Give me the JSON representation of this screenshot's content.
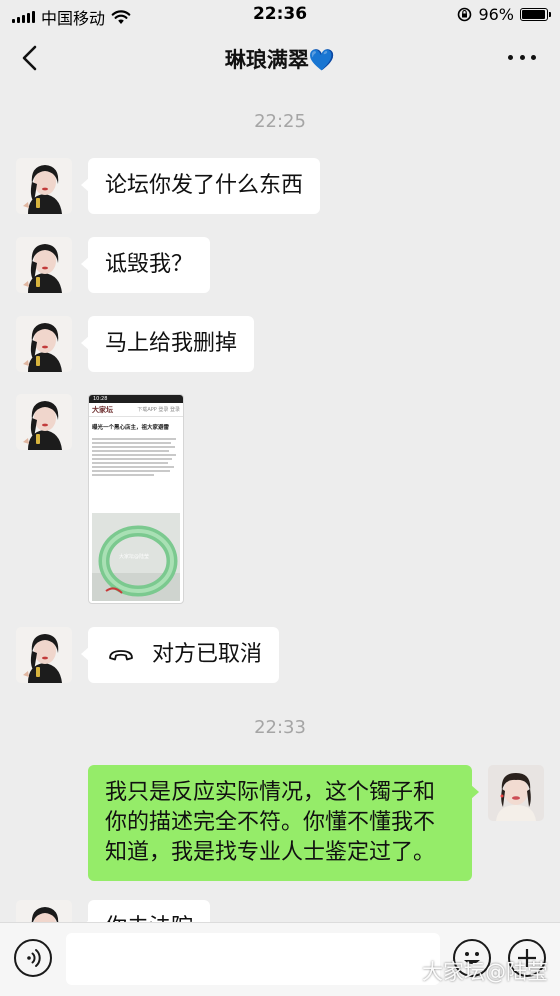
{
  "status_bar": {
    "carrier": "中国移动",
    "time": "22:36",
    "battery": "96%",
    "battery_level": 0.96
  },
  "header": {
    "title": "琳琅满翠💙"
  },
  "timestamps": [
    "22:25",
    "22:33"
  ],
  "messages": [
    {
      "side": "left",
      "text": "论坛你发了什么东西"
    },
    {
      "side": "left",
      "text": "诋毁我？"
    },
    {
      "side": "left",
      "text": "马上给我删掉"
    },
    {
      "side": "left",
      "type": "image"
    },
    {
      "side": "left",
      "type": "call",
      "text": "对方已取消"
    },
    {
      "side": "right",
      "text": "我只是反应实际情况，这个镯子和你的描述完全不符。你懂不懂我不知道，我是找专业人士鉴定过了。"
    },
    {
      "side": "left",
      "text": "你去法院"
    }
  ],
  "screenshot": {
    "time": "10:28",
    "logo": "大家坛",
    "header_links": "下载APP 登录 登录",
    "title": "曝光一个黑心店主，祖大家避雷",
    "watermark": "大家坛@陆莹"
  },
  "watermark": "大家坛@陆莹",
  "icons": {
    "voice": "voice-icon",
    "emoji": "emoji-icon",
    "plus": "plus-icon",
    "back": "back-icon",
    "more": "more-icon"
  }
}
